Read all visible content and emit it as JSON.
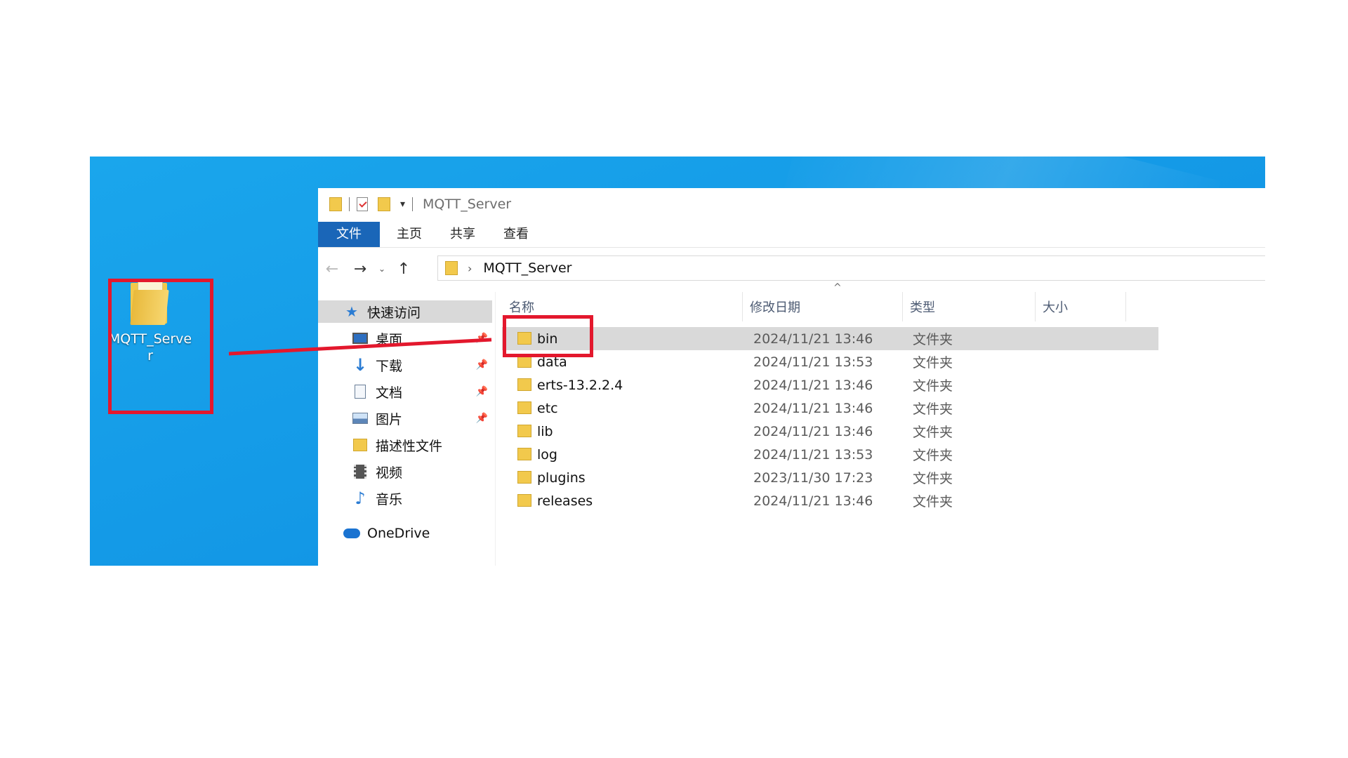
{
  "desktop": {
    "icon_label": "MQTT_Server"
  },
  "window": {
    "title": "MQTT_Server",
    "ribbon_tabs": [
      "文件",
      "主页",
      "共享",
      "查看"
    ],
    "address_path": "MQTT_Server"
  },
  "nav_pane": {
    "items": [
      {
        "label": "快速访问",
        "icon": "star-icon"
      },
      {
        "label": "桌面",
        "icon": "desktop-icon"
      },
      {
        "label": "下载",
        "icon": "download-arrow-icon"
      },
      {
        "label": "文档",
        "icon": "document-icon"
      },
      {
        "label": "图片",
        "icon": "picture-icon"
      },
      {
        "label": "描述性文件",
        "icon": "folder-icon"
      },
      {
        "label": "视频",
        "icon": "video-icon"
      },
      {
        "label": "音乐",
        "icon": "music-note-icon"
      },
      {
        "label": "OneDrive",
        "icon": "cloud-icon"
      }
    ]
  },
  "file_list": {
    "columns": [
      "名称",
      "修改日期",
      "类型",
      "大小"
    ],
    "rows": [
      {
        "name": "bin",
        "date": "2024/11/21 13:46",
        "type": "文件夹"
      },
      {
        "name": "data",
        "date": "2024/11/21 13:53",
        "type": "文件夹"
      },
      {
        "name": "erts-13.2.2.4",
        "date": "2024/11/21 13:46",
        "type": "文件夹"
      },
      {
        "name": "etc",
        "date": "2024/11/21 13:46",
        "type": "文件夹"
      },
      {
        "name": "lib",
        "date": "2024/11/21 13:46",
        "type": "文件夹"
      },
      {
        "name": "log",
        "date": "2024/11/21 13:53",
        "type": "文件夹"
      },
      {
        "name": "plugins",
        "date": "2023/11/30 17:23",
        "type": "文件夹"
      },
      {
        "name": "releases",
        "date": "2024/11/21 13:46",
        "type": "文件夹"
      }
    ]
  },
  "colors": {
    "desktop_blue": "#1398e6",
    "highlight_red": "#e3182d",
    "ribbon_file_blue": "#1a66b8",
    "selection_gray": "#d9d9d9",
    "folder_yellow": "#f2c94c"
  }
}
